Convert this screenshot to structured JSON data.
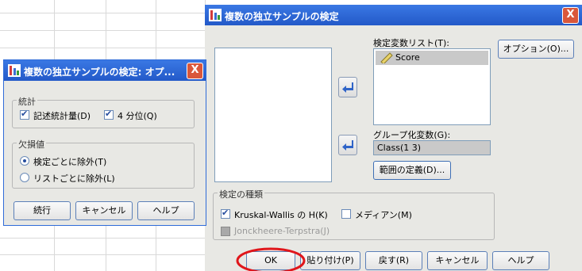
{
  "main_dialog": {
    "title": "複数の独立サンプルの検定",
    "close": "X",
    "test_var_list_label": "検定変数リスト(T):",
    "test_var_items": [
      "Score"
    ],
    "grouping_var_label": "グループ化変数(G):",
    "grouping_var_value": "Class(1 3)",
    "define_range_button": "範囲の定義(D)...",
    "options_button": "オプション(O)...",
    "test_type_group_label": "検定の種類",
    "tests": [
      {
        "label": "Kruskal-Wallis の H(K)",
        "checked": true,
        "enabled": true
      },
      {
        "label": "メディアン(M)",
        "checked": false,
        "enabled": true
      },
      {
        "label": "Jonckheere-Terpstra(J)",
        "checked": false,
        "enabled": false
      }
    ],
    "buttons": {
      "ok": "OK",
      "paste": "貼り付け(P)",
      "reset": "戻す(R)",
      "cancel": "キャンセル",
      "help": "ヘルプ"
    }
  },
  "options_dialog": {
    "title": "複数の独立サンプルの検定: オプ...",
    "close": "X",
    "stats_group_label": "統計",
    "stats": [
      {
        "label": "記述統計量(D)",
        "checked": true
      },
      {
        "label": "4 分位(Q)",
        "checked": true
      }
    ],
    "missing_group_label": "欠損値",
    "missing": [
      {
        "label": "検定ごとに除外(T)",
        "selected": true
      },
      {
        "label": "リストごとに除外(L)",
        "selected": false
      }
    ],
    "buttons": {
      "continue": "続行",
      "cancel": "キャンセル",
      "help": "ヘルプ"
    }
  },
  "colors": {
    "titlebar": "#2f6bd8",
    "dialog_bg": "#e8e8e4",
    "highlight_circle": "#e0161b",
    "selected_item": "#c9c9c9"
  }
}
